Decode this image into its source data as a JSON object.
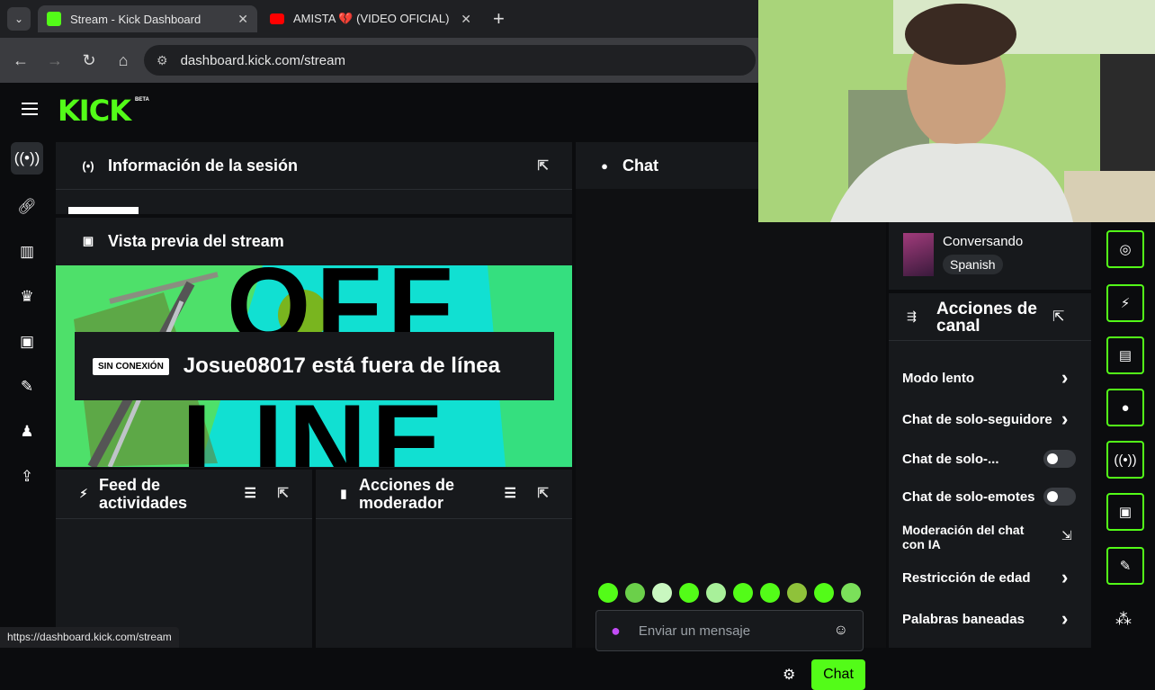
{
  "browser": {
    "tabs": [
      {
        "title": "Stream - Kick Dashboard",
        "close": "✕"
      },
      {
        "title": "AMISTA 💔 (VIDEO OFICIAL) | E",
        "close": "✕"
      }
    ],
    "new_tab": "+",
    "url": "dashboard.kick.com/stream",
    "status_url": "https://dashboard.kick.com/stream"
  },
  "app": {
    "logo": "KICK",
    "logo_badge": "BETA",
    "session_panel": {
      "title": "Información de la sesión"
    },
    "preview_panel": {
      "title": "Vista previa del stream",
      "offline_badge": "SIN CONEXIÓN",
      "offline_text": "Josue08017 está fuera de línea",
      "bg_word_top": "OFF",
      "bg_word_bottom": "LINE"
    },
    "feed_panel": {
      "title_l1": "Feed de",
      "title_l2": "actividades"
    },
    "mod_panel": {
      "title_l1": "Acciones de",
      "title_l2": "moderador"
    },
    "chat": {
      "title": "Chat",
      "input_placeholder": "Enviar un mensaje",
      "send_label": "Chat"
    },
    "category": {
      "name": "Conversando",
      "tag": "Spanish"
    },
    "channel_actions": {
      "title_l1": "Acciones de",
      "title_l2": "canal",
      "items": [
        {
          "label": "Modo lento",
          "control": "chevron"
        },
        {
          "label": "Chat de solo-seguidore",
          "control": "chevron"
        },
        {
          "label": "Chat de solo-...",
          "control": "toggle"
        },
        {
          "label": "Chat de solo-emotes",
          "control": "toggle"
        },
        {
          "label_l1": "Moderación del chat",
          "label_l2": "con IA",
          "control": "external"
        },
        {
          "label": "Restricción de edad",
          "control": "chevron"
        },
        {
          "label": "Palabras baneadas",
          "control": "chevron"
        }
      ]
    }
  },
  "colors": {
    "accent": "#53fc18",
    "bg": "#0b0c0e",
    "panel": "#17191c"
  },
  "icons": [
    "hamburger-icon",
    "stream-icon",
    "link-icon",
    "analytics-icon",
    "trophy-icon",
    "video-icon",
    "wrench-icon",
    "users-icon",
    "upload-icon"
  ]
}
